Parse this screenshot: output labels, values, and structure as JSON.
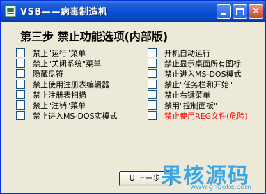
{
  "window": {
    "title": "VSB——病毒制造机",
    "icon": "app-icon",
    "titlebar_buttons": [
      "minimize",
      "maximize",
      "close"
    ],
    "close_glyph": "✕"
  },
  "step_title": "第三步  禁止功能选项(内部版)",
  "left_options": [
    {
      "label": "禁止\"运行\"菜单",
      "checked": false
    },
    {
      "label": "禁止\"关闭系统\"菜单",
      "checked": false
    },
    {
      "label": "隐藏盘符",
      "checked": false
    },
    {
      "label": "禁止使用注册表编辑器",
      "checked": false
    },
    {
      "label": "禁止注册表扫描",
      "checked": false
    },
    {
      "label": "禁止\"注销\"菜单",
      "checked": false
    },
    {
      "label": "禁止进入MS-DOS实模式",
      "checked": false
    }
  ],
  "right_options": [
    {
      "label": "开机自动运行",
      "checked": false
    },
    {
      "label": "禁止显示桌面所有图标",
      "checked": false
    },
    {
      "label": "禁止进入MS-DOS模式",
      "checked": false
    },
    {
      "label": "禁止\"任务栏和开始\"",
      "checked": false
    },
    {
      "label": "禁止右键菜单",
      "checked": false
    },
    {
      "label": "禁用\"控制面板\"",
      "checked": false
    },
    {
      "label": "禁止使用REG文件(危险)",
      "checked": false,
      "danger": true
    }
  ],
  "buttons": {
    "prev_label": "U 上一步"
  },
  "watermark": {
    "main": "果核源码",
    "sub": "www.ghboke.com"
  },
  "colors": {
    "titlebar": "#0a4fd4",
    "window_bg": "#ece9d8",
    "danger": "#ff0000",
    "watermark": "#3aa6e3"
  }
}
